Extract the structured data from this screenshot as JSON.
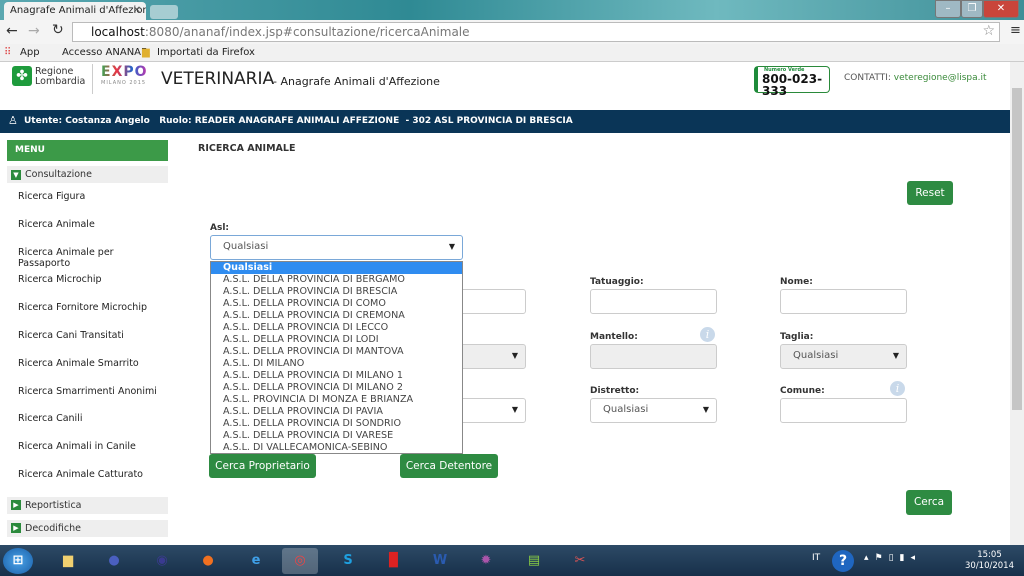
{
  "browser": {
    "tab_title": "Anagrafe Animali d'Affezione",
    "url_host": "localhost",
    "url_rest": ":8080/ananaf/index.jsp#consultazione/ricercaAnimale",
    "bookmarks": [
      "App",
      "Accesso ANANAF",
      "Importati da Firefox"
    ]
  },
  "header": {
    "brand_line1": "Regione",
    "brand_line2": "Lombardia",
    "expo": "EXPO",
    "expo_sub": "MILANO 2015",
    "title": "VETERINARIA",
    "subtitle": "- Anagrafe Animali d'Affezione",
    "phone_label": "Numero Verde",
    "phone": "800-023-333",
    "contacts_label": "CONTATTI:",
    "contacts_email": "veteregione@lispa.it"
  },
  "userbar": {
    "text": "Utente: Costanza Angelo   Ruolo: READER ANAGRAFE ANIMALI AFFEZIONE  - 302 ASL PROVINCIA DI BRESCIA"
  },
  "sidebar": {
    "menu": "MENU",
    "consultazione": "Consultazione",
    "items": [
      "Ricerca Figura",
      "Ricerca Animale",
      "Ricerca Animale per Passaporto",
      "Ricerca Microchip",
      "Ricerca Fornitore Microchip",
      "Ricerca Cani Transitati",
      "Ricerca Animale Smarrito",
      "Ricerca Smarrimenti Anonimi",
      "Ricerca Canili",
      "Ricerca Animali in Canile",
      "Ricerca Animale Catturato"
    ],
    "reportistica": "Reportistica",
    "decodifiche": "Decodifiche"
  },
  "main": {
    "title": "RICERCA ANIMALE",
    "reset": "Reset",
    "asl_label": "Asl:",
    "asl_value": "Qualsiasi",
    "asl_options": [
      "Qualsiasi",
      "A.S.L. DELLA PROVINCIA DI BERGAMO",
      "A.S.L. DELLA PROVINCIA DI BRESCIA",
      "A.S.L. DELLA PROVINCIA DI COMO",
      "A.S.L. DELLA PROVINCIA DI CREMONA",
      "A.S.L. DELLA PROVINCIA DI LECCO",
      "A.S.L. DELLA PROVINCIA DI LODI",
      "A.S.L. DELLA PROVINCIA DI MANTOVA",
      "A.S.L. DI MILANO",
      "A.S.L. DELLA PROVINCIA DI MILANO 1",
      "A.S.L. DELLA PROVINCIA DI MILANO 2",
      "A.S.L. PROVINCIA DI MONZA E BRIANZA",
      "A.S.L. DELLA PROVINCIA DI PAVIA",
      "A.S.L. DELLA PROVINCIA DI SONDRIO",
      "A.S.L. DELLA PROVINCIA DI VARESE",
      "A.S.L. DI VALLECAMONICA-SEBINO"
    ],
    "tatuaggio": "Tatuaggio:",
    "nome": "Nome:",
    "mantello": "Mantello:",
    "taglia": "Taglia:",
    "taglia_value": "Qualsiasi",
    "distretto": "Distretto:",
    "distretto_value": "Qualsiasi",
    "comune": "Comune:",
    "cerca_proprietario": "Cerca Proprietario",
    "cerca_detentore": "Cerca Detentore",
    "cerca": "Cerca"
  },
  "taskbar": {
    "lang": "IT",
    "time": "15:05",
    "date": "30/10/2014"
  },
  "colors": {
    "green": "#2e8b42",
    "navy": "#0a3557",
    "highlight": "#2f8cf0"
  }
}
